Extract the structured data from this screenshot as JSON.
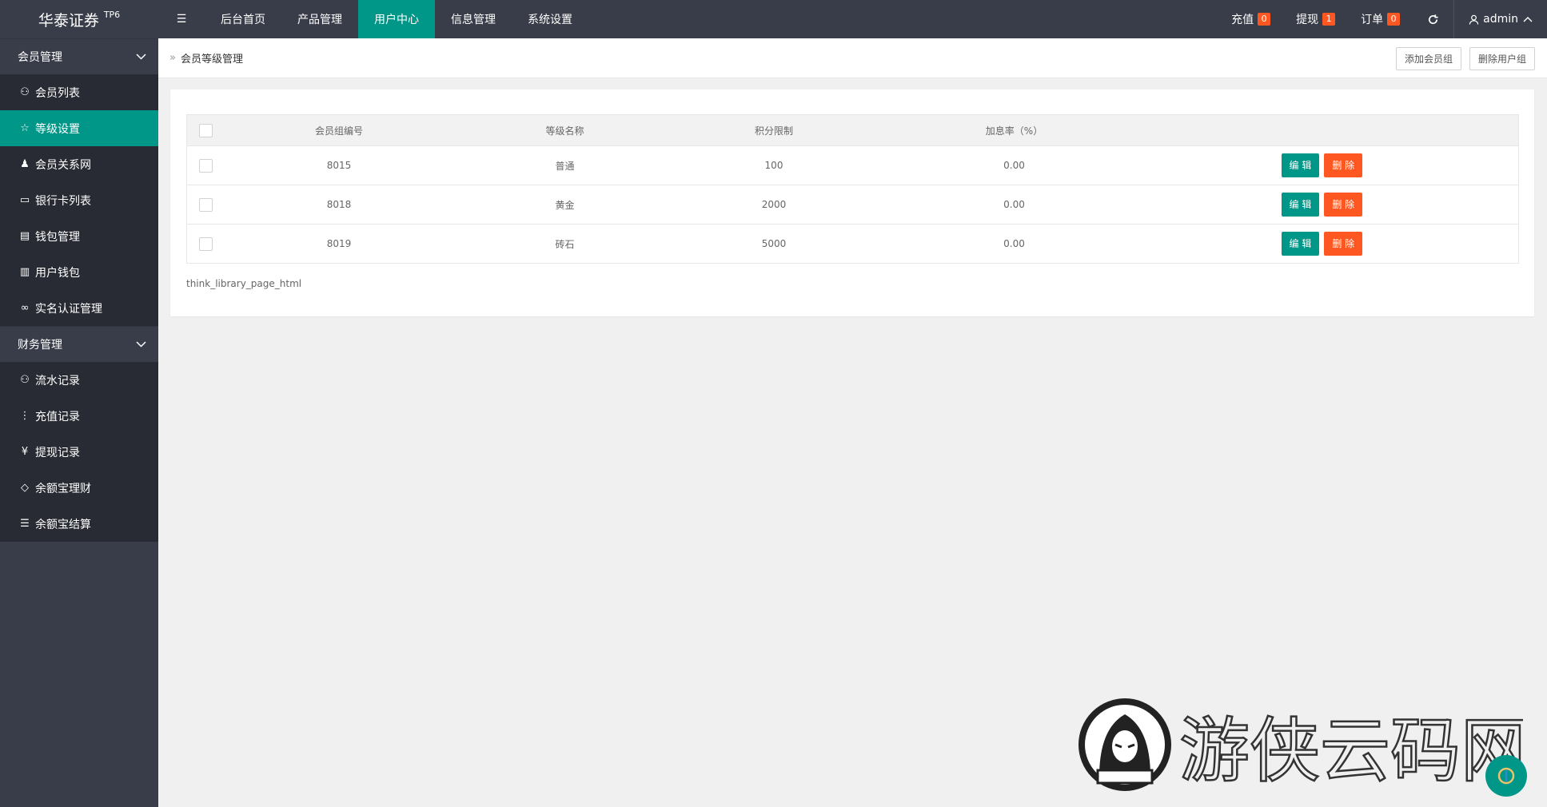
{
  "app": {
    "title": "华泰证券",
    "version": "TP6"
  },
  "topnav": {
    "menu_toggle": "☰",
    "items": [
      "后台首页",
      "产品管理",
      "用户中心",
      "信息管理",
      "系统设置"
    ],
    "active_index": 2
  },
  "topright": {
    "recharge": {
      "label": "充值",
      "count": "0"
    },
    "withdraw": {
      "label": "提现",
      "count": "1"
    },
    "orders": {
      "label": "订单",
      "count": "0"
    },
    "user": "admin"
  },
  "sidebar": {
    "groups": [
      {
        "label": "会员管理",
        "items": [
          {
            "label": "会员列表",
            "icon": "user-icon"
          },
          {
            "label": "等级设置",
            "icon": "star-icon",
            "active": true
          },
          {
            "label": "会员关系网",
            "icon": "users-icon"
          },
          {
            "label": "银行卡列表",
            "icon": "card-icon"
          },
          {
            "label": "钱包管理",
            "icon": "book-icon"
          },
          {
            "label": "用户钱包",
            "icon": "open-book-icon"
          },
          {
            "label": "实名认证管理",
            "icon": "link-icon"
          }
        ]
      },
      {
        "label": "财务管理",
        "items": [
          {
            "label": "流水记录",
            "icon": "user-icon"
          },
          {
            "label": "充值记录",
            "icon": "more-icon"
          },
          {
            "label": "提现记录",
            "icon": "yen-icon"
          },
          {
            "label": "余额宝理财",
            "icon": "diamond-icon"
          },
          {
            "label": "余额宝结算",
            "icon": "list-icon"
          }
        ]
      }
    ]
  },
  "breadcrumb": {
    "title": "会员等级管理"
  },
  "actions": {
    "add": "添加会员组",
    "delete": "删除用户组"
  },
  "table": {
    "headers": [
      "会员组编号",
      "等级名称",
      "积分限制",
      "加息率（%）"
    ],
    "rows": [
      {
        "id": "8015",
        "name": "普通",
        "points": "100",
        "rate": "0.00"
      },
      {
        "id": "8018",
        "name": "黄金",
        "points": "2000",
        "rate": "0.00"
      },
      {
        "id": "8019",
        "name": "砖石",
        "points": "5000",
        "rate": "0.00"
      }
    ],
    "edit_label": "编 辑",
    "delete_label": "删 除"
  },
  "pager": "think_library_page_html",
  "watermark": {
    "text": "游侠云码网"
  },
  "colors": {
    "accent": "#009688",
    "danger": "#ff5722",
    "dark": "#393d49",
    "darker": "#282b33"
  }
}
